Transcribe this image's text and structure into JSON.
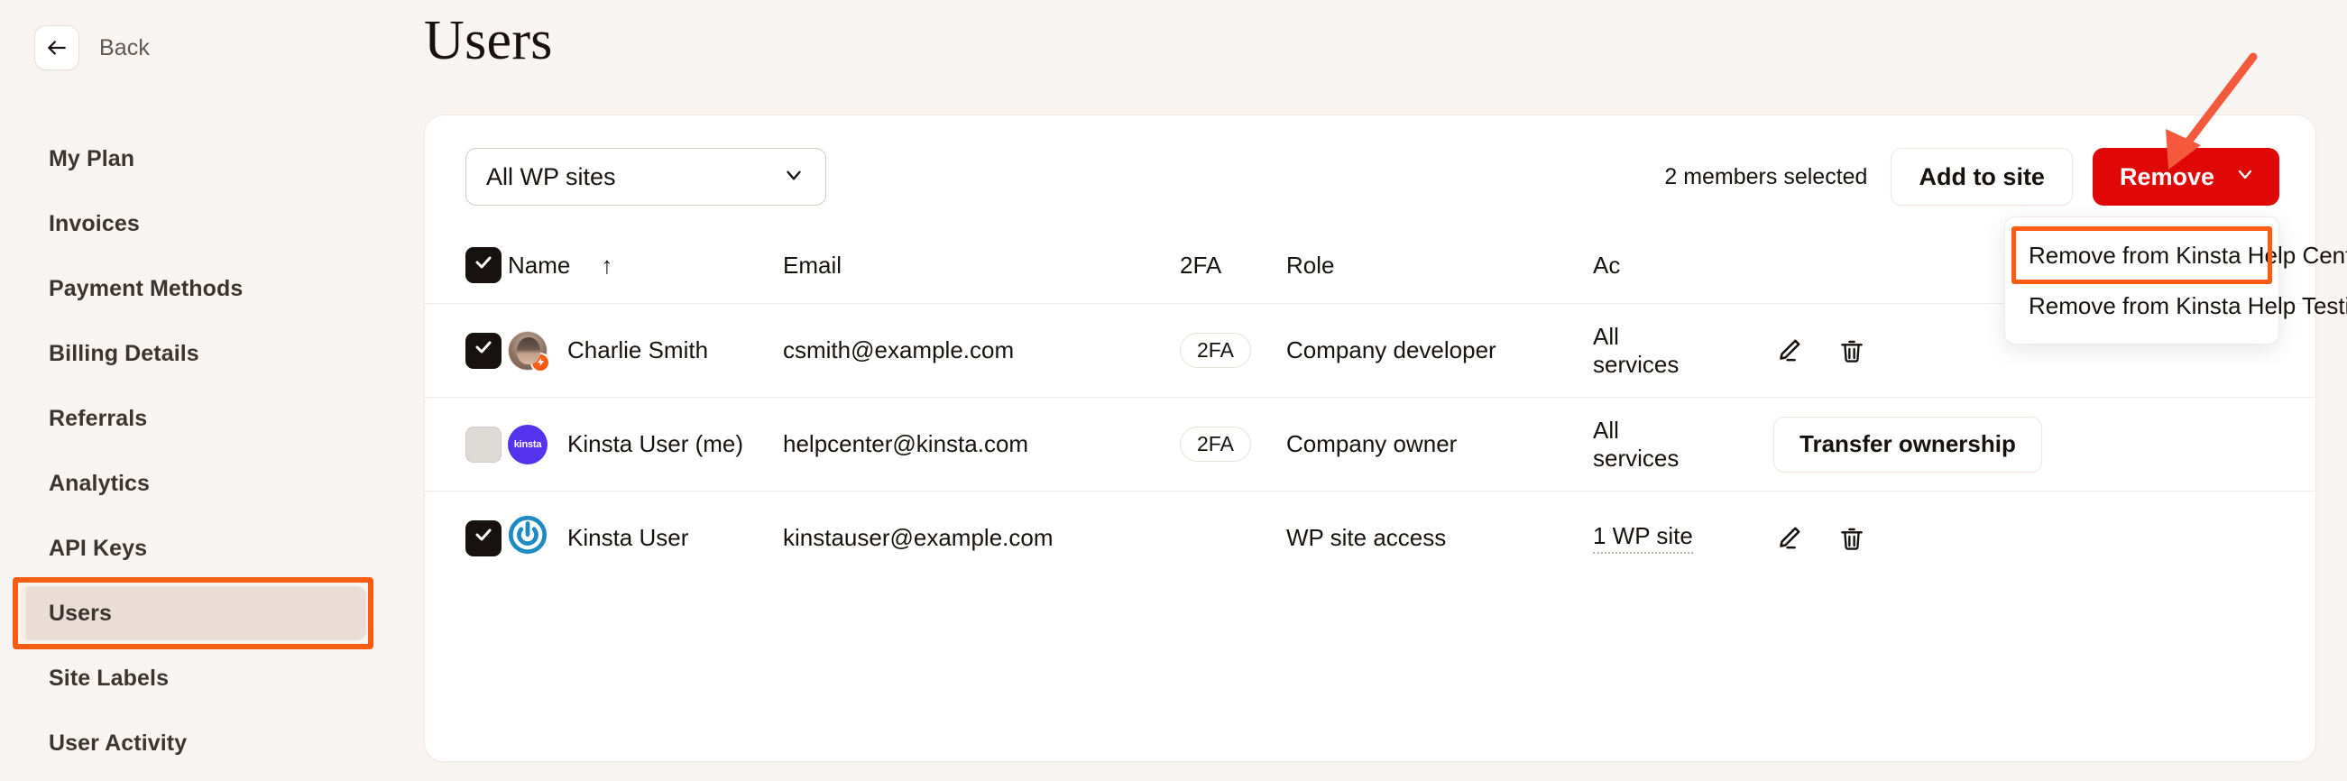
{
  "sidebar": {
    "back_label": "Back",
    "back_icon": "arrow-left-icon",
    "items": [
      {
        "label": "My Plan",
        "selected": false
      },
      {
        "label": "Invoices",
        "selected": false
      },
      {
        "label": "Payment Methods",
        "selected": false
      },
      {
        "label": "Billing Details",
        "selected": false
      },
      {
        "label": "Referrals",
        "selected": false
      },
      {
        "label": "Analytics",
        "selected": false
      },
      {
        "label": "API Keys",
        "selected": false
      },
      {
        "label": "Users",
        "selected": true
      },
      {
        "label": "Site Labels",
        "selected": false
      },
      {
        "label": "User Activity",
        "selected": false
      }
    ]
  },
  "header": {
    "title": "Users"
  },
  "toolbar": {
    "site_filter": {
      "value": "All WP sites",
      "icon": "chevron-down-icon"
    },
    "selection_text": "2 members selected",
    "add_to_site_label": "Add to site",
    "remove_label": "Remove",
    "remove_caret_icon": "chevron-down-icon",
    "remove_color": "#e00707"
  },
  "dropdown": {
    "items": [
      {
        "label": "Remove from Kinsta Help Center",
        "highlighted": true
      },
      {
        "label": "Remove from Kinsta Help Testing",
        "highlighted": false
      }
    ]
  },
  "annotations": {
    "arrow_color": "#f4593c",
    "highlight_color": "#fa5c14"
  },
  "table": {
    "columns": {
      "name": "Name",
      "sort_indicator": "↑",
      "email": "Email",
      "twofa": "2FA",
      "role": "Role",
      "access": "Ac"
    },
    "header_checkbox": {
      "checked": true,
      "icon": "check-icon"
    },
    "rows": [
      {
        "checked": true,
        "avatar": "user-photo-avatar",
        "avatar_badge": "bolt-badge-icon",
        "name": "Charlie Smith",
        "email": "csmith@example.com",
        "twofa": "2FA",
        "role": "Company developer",
        "access_line1": "All",
        "access_line2": "services",
        "access_dotted": false,
        "actions": [
          "edit-icon",
          "delete-icon"
        ],
        "transfer_label": ""
      },
      {
        "checked": false,
        "avatar": "kinsta-logo-avatar",
        "avatar_text": "kinsta",
        "avatar_badge": "",
        "name": "Kinsta User (me)",
        "email": "helpcenter@kinsta.com",
        "twofa": "2FA",
        "role": "Company owner",
        "access_line1": "All",
        "access_line2": "services",
        "access_dotted": false,
        "actions": [],
        "transfer_label": "Transfer ownership"
      },
      {
        "checked": true,
        "avatar": "gravatar-power-avatar",
        "avatar_badge": "",
        "name": "Kinsta User",
        "email": "kinstauser@example.com",
        "twofa": "",
        "role": "WP site access",
        "access_line1": "1 WP site",
        "access_line2": "",
        "access_dotted": true,
        "actions": [
          "edit-icon",
          "delete-icon"
        ],
        "transfer_label": ""
      }
    ]
  }
}
